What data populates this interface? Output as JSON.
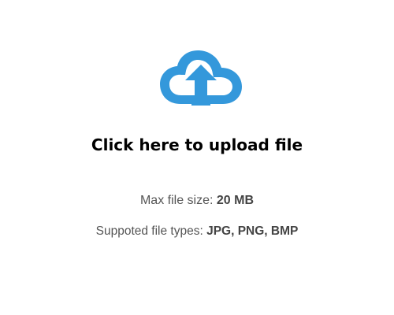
{
  "upload": {
    "icon": "cloud-upload-icon",
    "title": "Click here to upload file",
    "max_size_label": "Max file size:",
    "max_size_value": "20 MB",
    "types_label": "Suppoted file types:",
    "types_value": "JPG, PNG, BMP"
  },
  "colors": {
    "icon": "#3498db",
    "title": "#000000",
    "info_text": "#555555"
  }
}
